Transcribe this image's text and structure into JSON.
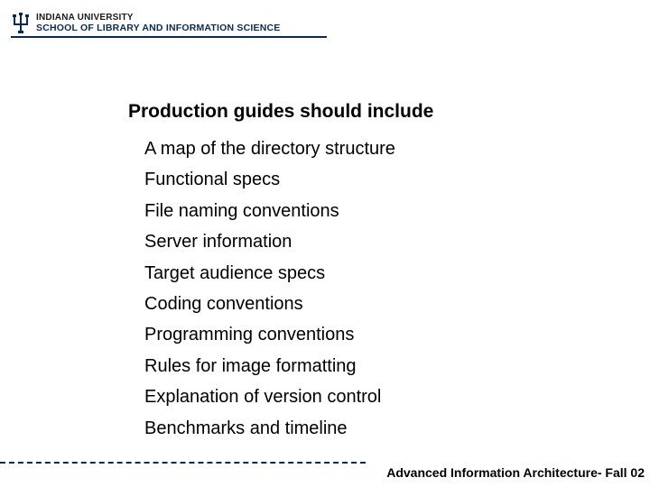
{
  "brand": {
    "line1": "INDIANA UNIVERSITY",
    "line2": "SCHOOL OF LIBRARY AND INFORMATION SCIENCE"
  },
  "content": {
    "heading": "Production guides should include",
    "items": [
      "A map of the directory structure",
      "Functional specs",
      "File naming conventions",
      "Server information",
      "Target audience specs",
      "Coding conventions",
      "Programming conventions",
      "Rules for image formatting",
      "Explanation of version control",
      "Benchmarks and timeline"
    ]
  },
  "footer": {
    "text": "Advanced Information Architecture- Fall 02"
  }
}
